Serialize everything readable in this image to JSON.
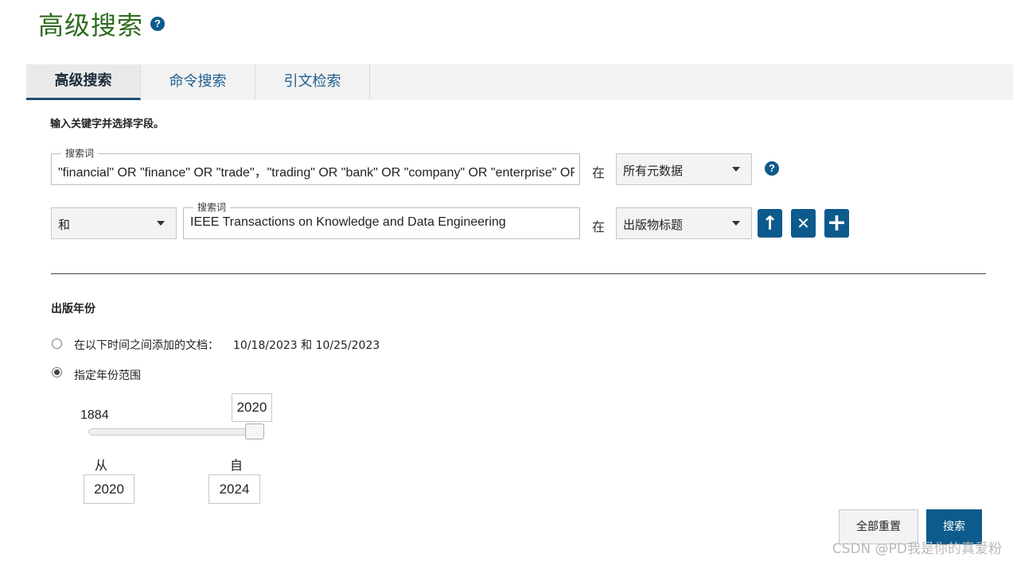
{
  "header": {
    "title": "高级搜索",
    "help_icon": "?"
  },
  "tabs": [
    {
      "label": "高级搜索",
      "active": true
    },
    {
      "label": "命令搜索",
      "active": false
    },
    {
      "label": "引文检索",
      "active": false
    }
  ],
  "instruction": "输入关键字并选择字段。",
  "rows": [
    {
      "legend": "搜索词",
      "value": "\"financial\" OR \"finance\" OR \"trade\"，\"trading\" OR \"bank\" OR \"company\" OR \"enterprise\" OR",
      "in_label": "在",
      "field_select": "所有元数据",
      "help_icon": "?"
    },
    {
      "operator": "和",
      "legend": "搜索词",
      "value": "IEEE Transactions on Knowledge and Data Engineering",
      "in_label": "在",
      "field_select": "出版物标题",
      "buttons": {
        "up": "↑",
        "remove": "✕",
        "add": "+"
      }
    }
  ],
  "year_section": {
    "title": "出版年份",
    "options": [
      {
        "label": "在以下时间之间添加的文档：",
        "range": "10/18/2023 和 10/25/2023",
        "checked": false
      },
      {
        "label": "指定年份范围",
        "checked": true
      }
    ],
    "slider": {
      "min_label": "1884",
      "current": "2020"
    },
    "from_label": "从",
    "to_label": "自",
    "from_value": "2020",
    "to_value": "2024"
  },
  "actions": {
    "reset": "全部重置",
    "search": "搜索"
  },
  "watermark": "CSDN @PD我是你的真爱粉",
  "colors": {
    "accent": "#0d5a8c",
    "title_green": "#2e6b1f",
    "tab_bg": "#f2f2f2"
  }
}
